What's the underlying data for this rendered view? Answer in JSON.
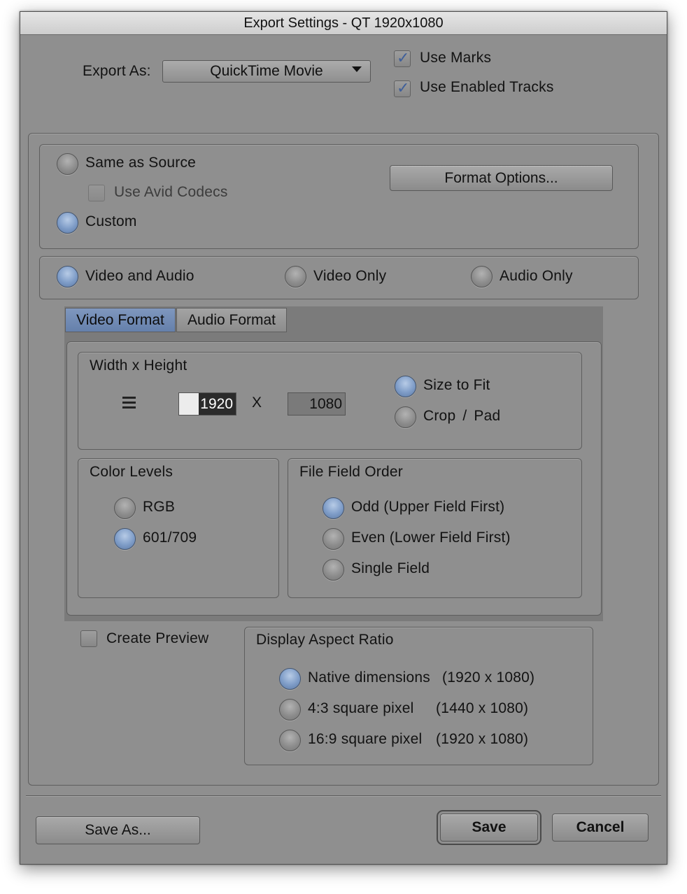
{
  "window": {
    "title": "Export Settings - QT 1920x1080"
  },
  "export_as": {
    "label": "Export As:",
    "value": "QuickTime Movie"
  },
  "options": {
    "use_marks": "Use Marks",
    "use_enabled_tracks": "Use Enabled Tracks"
  },
  "source": {
    "same_as_source": "Same as Source",
    "use_avid_codecs": "Use Avid Codecs",
    "custom": "Custom",
    "format_options": "Format Options..."
  },
  "tracks": {
    "video_and_audio": "Video and Audio",
    "video_only": "Video Only",
    "audio_only": "Audio Only"
  },
  "tabs": {
    "video_format": "Video Format",
    "audio_format": "Audio Format"
  },
  "size": {
    "title": "Width x Height",
    "width": "1920",
    "separator": "X",
    "height": "1080",
    "size_to_fit": "Size to Fit",
    "crop_pad": "Crop / Pad"
  },
  "color_levels": {
    "title": "Color Levels",
    "rgb": "RGB",
    "rec": "601/709"
  },
  "field_order": {
    "title": "File Field Order",
    "odd": "Odd (Upper Field First)",
    "even": "Even (Lower Field First)",
    "single": "Single Field"
  },
  "preview": {
    "label": "Create Preview"
  },
  "aspect": {
    "title": "Display Aspect Ratio",
    "native_name": "Native dimensions",
    "native_dims": "(1920 x 1080)",
    "four_three_name": "4:3 square pixel",
    "four_three_dims": "(1440 x 1080)",
    "sixteen_nine_name": "16:9 square pixel",
    "sixteen_nine_dims": "(1920 x 1080)"
  },
  "buttons": {
    "save_as": "Save As...",
    "save": "Save",
    "cancel": "Cancel"
  },
  "colors": {
    "window_bg": "#8f8f8f",
    "radio_selected": "#7e9cc7",
    "tab_active": "#6c84ad",
    "check_mark": "#3f5f9a"
  }
}
